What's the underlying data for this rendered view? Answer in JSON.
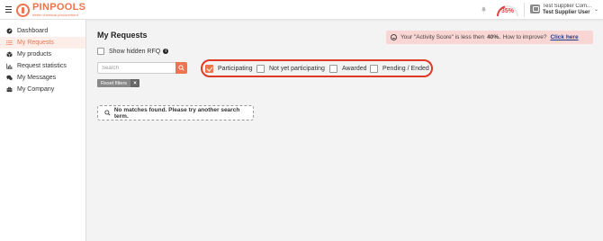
{
  "brand": {
    "name": "PINPOOLS",
    "tagline": "better chemical procurement",
    "accent": "#ee7450"
  },
  "header": {
    "activity_score": "35%",
    "user_company": "Test Supplier Com...",
    "user_name": "Test Supplier User"
  },
  "sidebar": {
    "items": [
      {
        "label": "Dashboard",
        "icon": "dashboard-icon"
      },
      {
        "label": "My Requests",
        "icon": "list-icon",
        "active": true
      },
      {
        "label": "My products",
        "icon": "box-icon"
      },
      {
        "label": "Request statistics",
        "icon": "chart-icon"
      },
      {
        "label": "My Messages",
        "icon": "chat-icon"
      },
      {
        "label": "My Company",
        "icon": "briefcase-icon"
      }
    ]
  },
  "main": {
    "title": "My Requests",
    "alert": {
      "prefix": "Your \"Activity Score\" is less then",
      "value": "40%.",
      "suffix": "How to improve?",
      "link": "Click here",
      "color": "#f9d6d3"
    },
    "show_hidden_label": "Show hidden RFQ",
    "search_placeholder": "Search",
    "filters": [
      {
        "label": "Participating",
        "checked": true
      },
      {
        "label": "Not yet participating",
        "checked": false
      },
      {
        "label": "Awarded",
        "checked": false
      },
      {
        "label": "Pending / Ended",
        "checked": false
      }
    ],
    "reset_label": "Reset filters",
    "reset_x": "×",
    "no_matches": "No matches found. Please try another search term."
  }
}
